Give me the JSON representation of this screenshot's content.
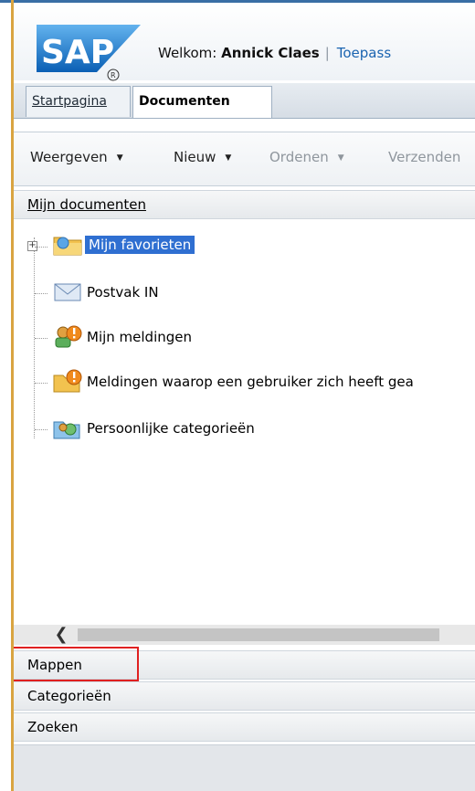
{
  "header": {
    "logo_text": "SAP",
    "welcome_prefix": "Welkom:",
    "user_name": "Annick Claes",
    "separator": "|",
    "app_link": "Toepass"
  },
  "tabs": [
    {
      "label": "Startpagina",
      "active": false
    },
    {
      "label": "Documenten",
      "active": true
    }
  ],
  "toolbar": [
    {
      "label": "Weergeven",
      "disabled": false
    },
    {
      "label": "Nieuw",
      "disabled": false
    },
    {
      "label": "Ordenen",
      "disabled": true
    },
    {
      "label": "Verzenden",
      "disabled": true
    }
  ],
  "dropdown_glyph": "▼",
  "my_documents": {
    "title": "Mijn documenten",
    "tree": [
      {
        "label": "Mijn favorieten",
        "icon": "folder-star-icon",
        "expandable": true,
        "selected": true
      },
      {
        "label": "Postvak IN",
        "icon": "inbox-envelope-icon",
        "expandable": false,
        "selected": false
      },
      {
        "label": "Mijn meldingen",
        "icon": "alert-user-icon",
        "expandable": false,
        "selected": false
      },
      {
        "label": "Meldingen waarop een gebruiker zich heeft gea",
        "icon": "alert-folder-icon",
        "expandable": false,
        "selected": false
      },
      {
        "label": "Persoonlijke categorieën",
        "icon": "personal-categories-icon",
        "expandable": false,
        "selected": false
      }
    ]
  },
  "scroll_left_glyph": "❮",
  "sections": {
    "folders": "Mappen",
    "categories": "Categorieën",
    "search": "Zoeken"
  },
  "colors": {
    "accent": "#3a6ea5",
    "selection": "#2f6fd1",
    "link": "#1a64b0",
    "highlight": "#e02020",
    "left_rule": "#d9a441"
  }
}
